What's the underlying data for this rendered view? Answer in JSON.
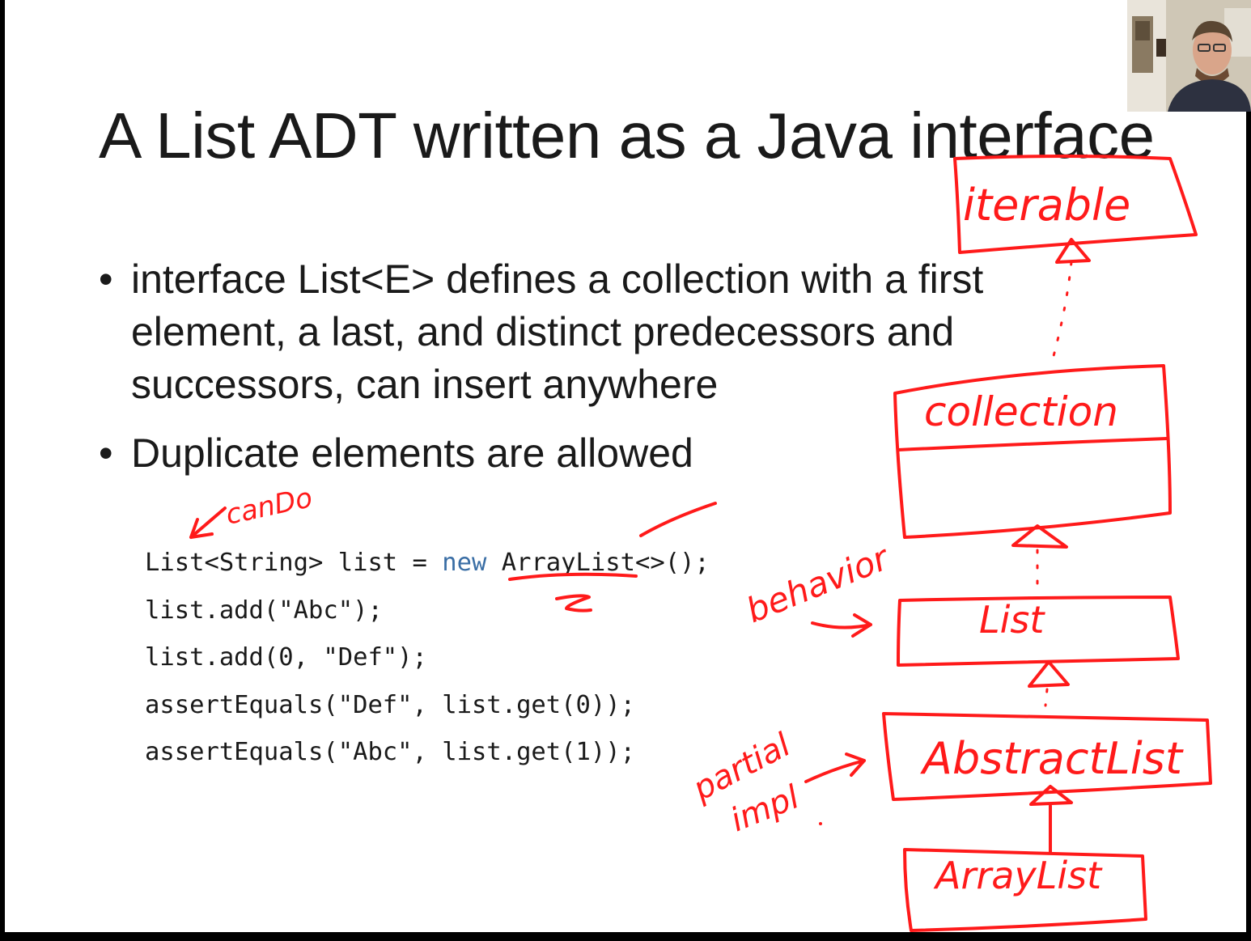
{
  "slide": {
    "title": "A List ADT written as a Java interface",
    "bullets": [
      "interface List<E> defines a collection with a first element, a last, and distinct predecessors and successors, can insert anywhere",
      "Duplicate elements are allowed"
    ],
    "code": {
      "line1_a": "List<String> list = ",
      "line1_kw": "new",
      "line1_b": " ArrayList<>();",
      "line2": "list.add(\"Abc\");",
      "line3": "list.add(0, \"Def\");",
      "line4": "assertEquals(\"Def\", list.get(0));",
      "line5": "assertEquals(\"Abc\", list.get(1));"
    }
  },
  "annotations": {
    "ink_color": "#ff1a1a",
    "candoLabel": "canDo",
    "behaviorLabel": "behavior",
    "partialLabel": "partial",
    "implLabel": "impl",
    "boxes": {
      "iterable": "iterable",
      "collection": "collection",
      "list": "List",
      "abstractList": "AbstractList",
      "arrayList": "ArrayList"
    }
  },
  "webcam": {
    "icon": "presenter-video-thumbnail"
  }
}
